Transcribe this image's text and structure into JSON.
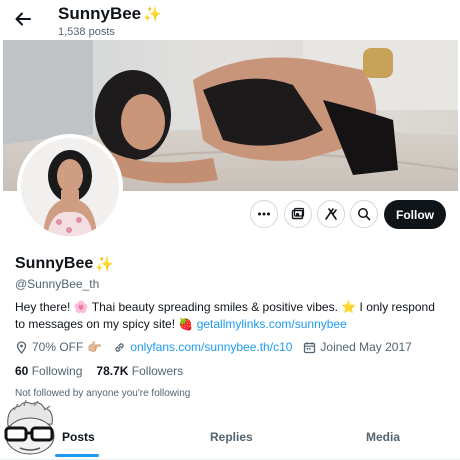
{
  "header": {
    "title": "SunnyBee",
    "title_emoji": "✨",
    "post_count": "1,538 posts"
  },
  "profile": {
    "name": "SunnyBee",
    "name_emoji": "✨",
    "handle": "@SunnyBee_th",
    "bio": {
      "part1": "Hey there! ",
      "emoji_flower": "🌸",
      "part2": " Thai beauty spreading smiles & positive vibes. ",
      "emoji_star": "⭐",
      "part3": " I only respond to messages on my spicy site! ",
      "emoji_strawberry": "🍓",
      "link": "getallmylinks.com/sunnybee"
    },
    "meta": {
      "location": "70% OFF",
      "location_emoji": "👉🏼",
      "website": "onlyfans.com/sunnybee.th/c10",
      "joined": "Joined May 2017"
    },
    "stats": {
      "following_count": "60",
      "following_label": "Following",
      "followers_count": "78.7K",
      "followers_label": "Followers"
    },
    "followed_note": "Not followed by anyone you're following"
  },
  "actions": {
    "follow_label": "Follow"
  },
  "tabs": [
    "Posts",
    "Replies",
    "Media"
  ],
  "colors": {
    "accent": "#1d9bf0",
    "text": "#0f1419",
    "muted": "#536471",
    "button_dark": "#0f1419"
  },
  "icons": [
    "back-arrow-icon",
    "more-icon",
    "subscribe-icon",
    "grok-icon",
    "search-icon",
    "location-icon",
    "link-icon",
    "calendar-icon"
  ]
}
